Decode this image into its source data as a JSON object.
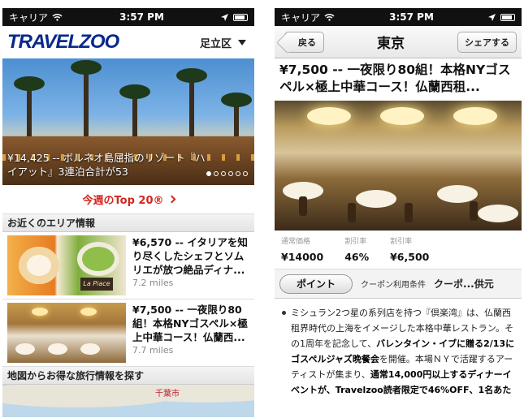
{
  "status_bar": {
    "carrier": "キャリア",
    "time": "3:57 PM"
  },
  "left": {
    "logo": "TRAVELZOO",
    "region": "足立区",
    "hero_caption": "¥14,425 -- ボルネオ島屈指のリゾート『ハイアット』3連泊合計が53",
    "top20": "今週のTop 20®",
    "nearby_header": "お近くのエリア情報",
    "deals": [
      {
        "title": "¥6,570 -- イタリアを知り尽くしたシェフとソムリエが放つ絶品ディナ...",
        "miles": "7.2 miles",
        "sign": "La Piace"
      },
      {
        "title": "¥7,500 -- 一夜限り80組！本格NYゴスペル×極上中華コース！仏蘭西...",
        "miles": "7.7 miles"
      }
    ],
    "map_header": "地図からお得な旅行情報を探す",
    "map_label": "千葉市"
  },
  "right": {
    "back": "戻る",
    "title": "東京",
    "share": "シェアする",
    "detail_title": "¥7,500 -- 一夜限り80組！本格NYゴスペル×極上中華コース！仏蘭西租...",
    "prices": [
      {
        "label": "通常価格",
        "value": "¥14000"
      },
      {
        "label": "割引率",
        "value": "46%"
      },
      {
        "label": "割引率",
        "value": "¥6,500"
      }
    ],
    "tabs": {
      "active": "ポイント",
      "coupon": "クーポン利用条件",
      "provider": "クーポ...供元"
    },
    "body": {
      "p1": "ミシュラン2つ星の系列店を持つ『倶楽湾』は、仏蘭西租界時代の上海をイメージした本格中華レストラン。その1周年を記念して、",
      "b1": "バレンタイン・イブに贈る2/13にゴスペルジャズ晩餐会",
      "p2": "を開催。本場ＮＹで活躍するアーティストが集まり、",
      "b2": "通常14,000円以上するディナーイベントが、Travelzoo読者限定で46%OFF、1名あた"
    }
  }
}
